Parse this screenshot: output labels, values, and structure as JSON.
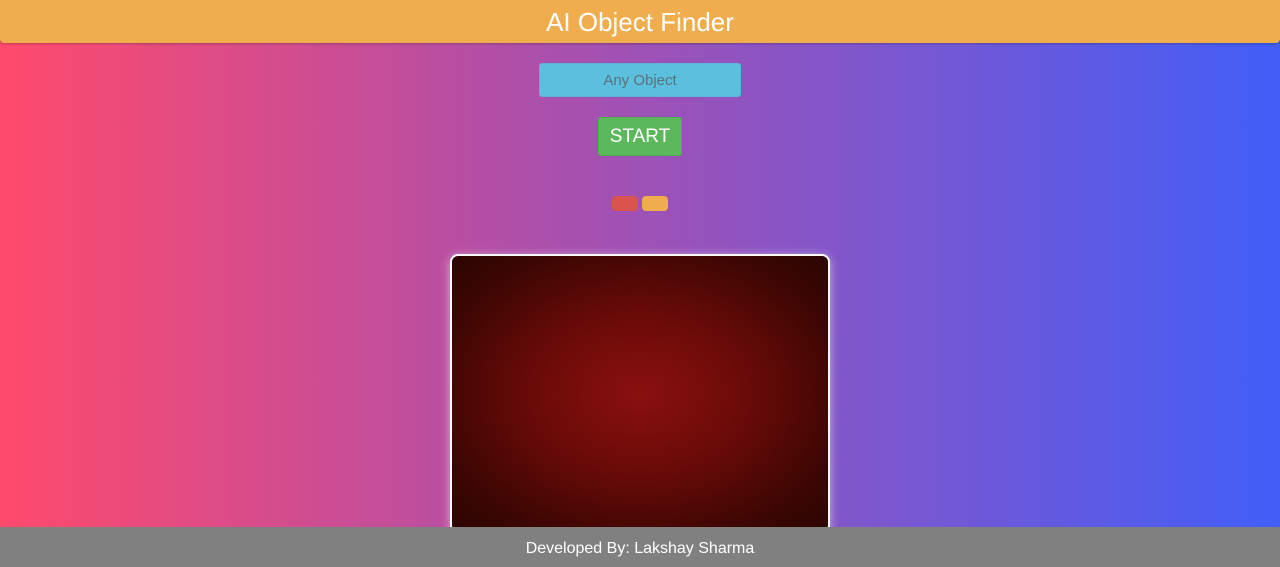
{
  "header": {
    "title": "AI Object Finder"
  },
  "search": {
    "placeholder": "Any Object",
    "value": ""
  },
  "controls": {
    "start_label": "START"
  },
  "indicators": [
    {
      "name": "red-indicator",
      "color": "#d9534f"
    },
    {
      "name": "orange-indicator",
      "color": "#f0ad4e"
    }
  ],
  "colors": {
    "header": "#f0ad4e",
    "input": "#5bc0de",
    "start_button": "#5cb85c",
    "footer": "#808080",
    "video_feed": "#6a0b08"
  },
  "footer": {
    "credit": "Developed By: Lakshay Sharma"
  }
}
